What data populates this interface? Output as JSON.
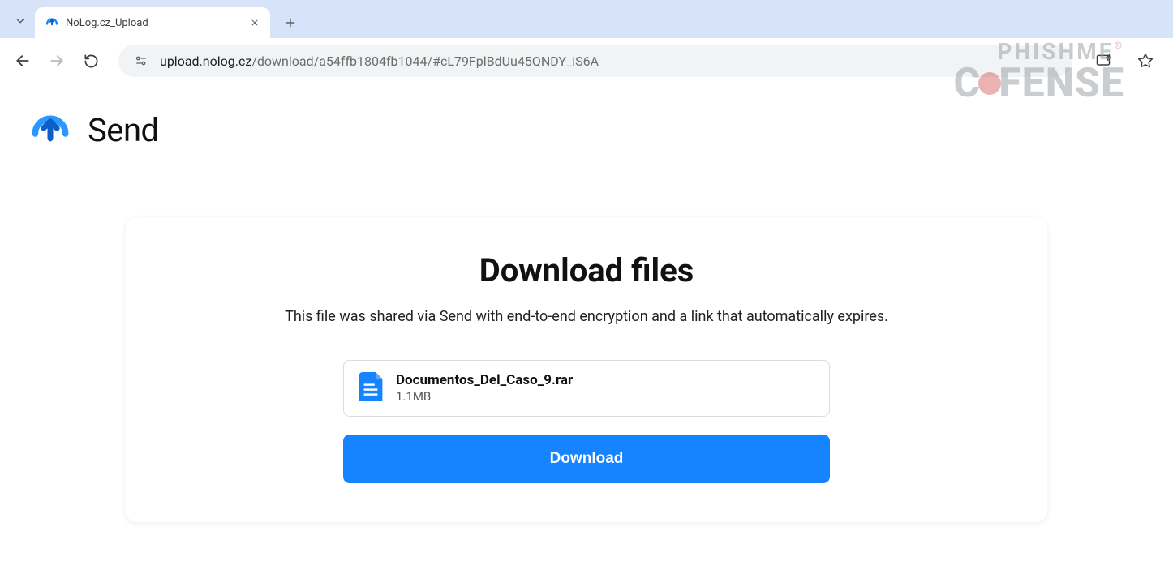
{
  "browser": {
    "tab_title": "NoLog.cz_Upload",
    "url_host": "upload.nolog.cz",
    "url_path": "/download/a54ffb1804fb1044/#cL79FplBdUu45QNDY_iS6A"
  },
  "watermark": {
    "line1": "PHISHME",
    "line2_prefix": "C",
    "line2_suffix": "FENSE"
  },
  "brand": {
    "name": "Send"
  },
  "card": {
    "title": "Download files",
    "description": "This file was shared via Send with end-to-end encryption and a link that automatically expires."
  },
  "file": {
    "name": "Documentos_Del_Caso_9.rar",
    "size": "1.1MB"
  },
  "download": {
    "label": "Download"
  }
}
